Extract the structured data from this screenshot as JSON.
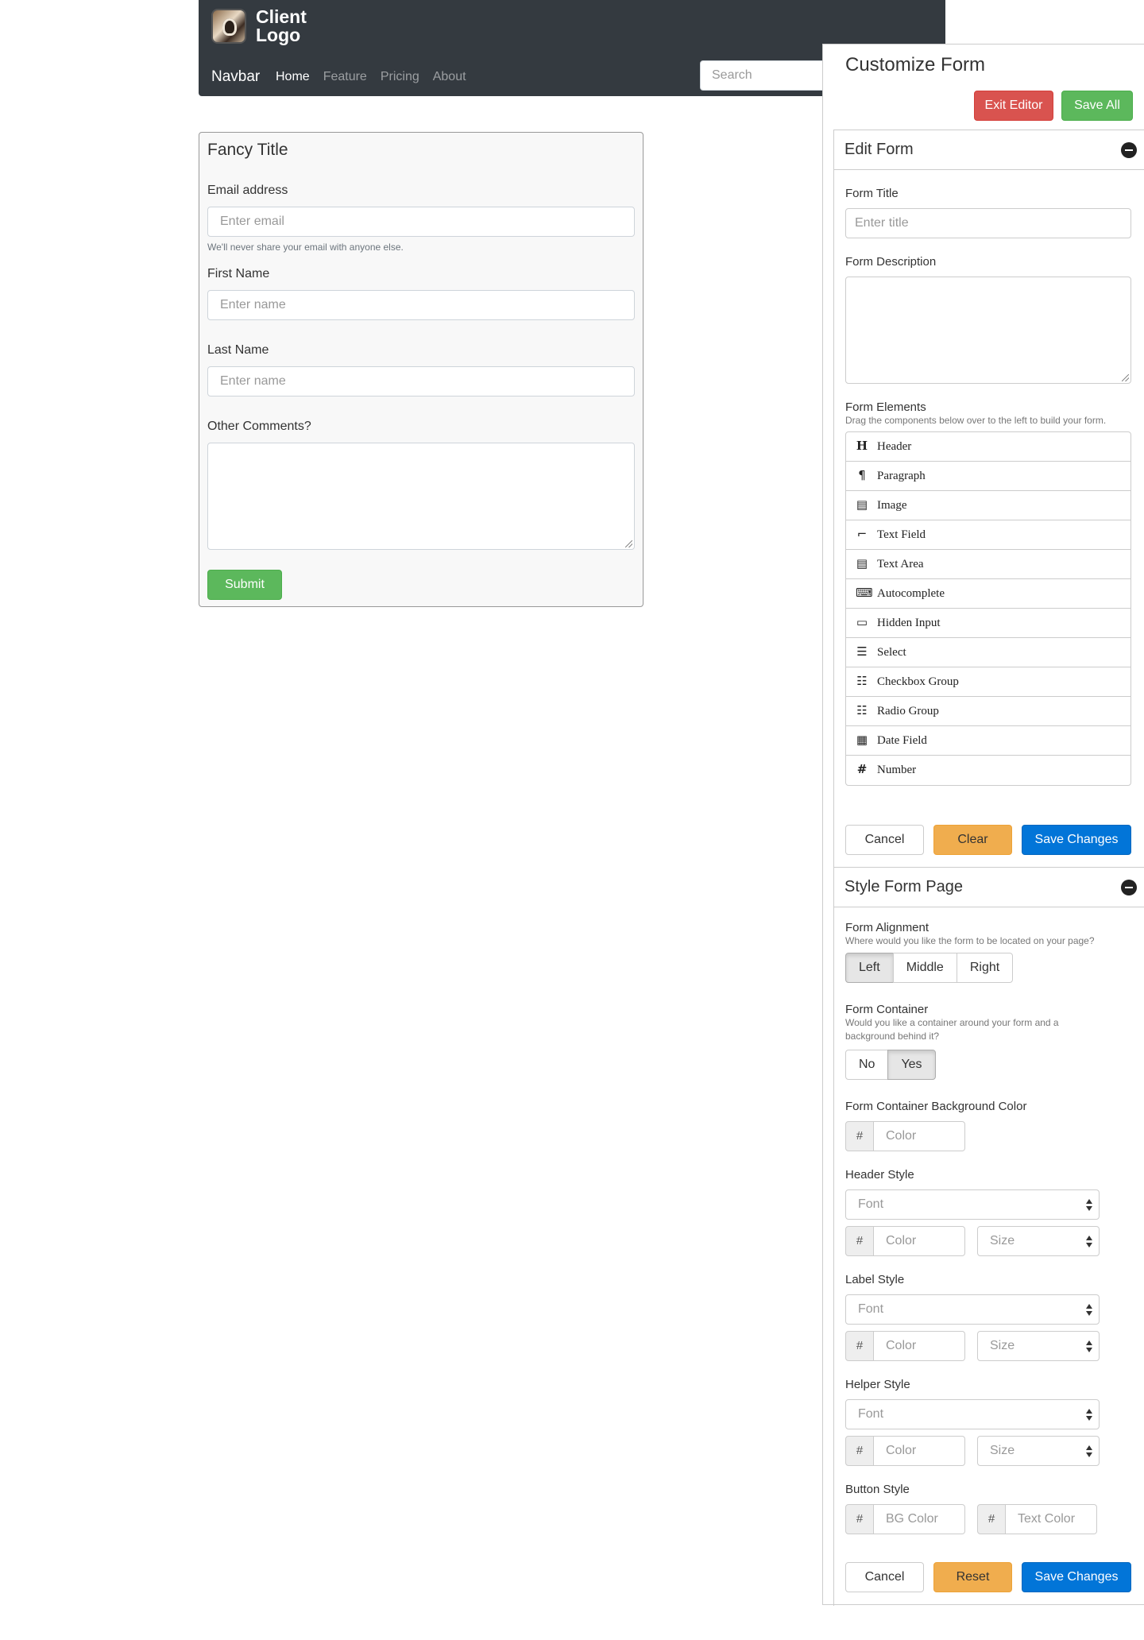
{
  "navbar": {
    "logo_line1": "Client",
    "logo_line2": "Logo",
    "brand": "Navbar",
    "links": [
      "Home",
      "Feature",
      "Pricing",
      "About"
    ],
    "search_placeholder": "Search"
  },
  "form": {
    "title": "Fancy Title",
    "email_label": "Email address",
    "email_placeholder": "Enter email",
    "email_help": "We'll never share your email with anyone else.",
    "first_name_label": "First Name",
    "first_name_placeholder": "Enter name",
    "last_name_label": "Last Name",
    "last_name_placeholder": "Enter name",
    "comments_label": "Other Comments?",
    "submit_label": "Submit"
  },
  "panel": {
    "toggle": "»",
    "title": "Customize Form",
    "exit_label": "Exit Editor",
    "save_all_label": "Save All",
    "edit_form": {
      "title": "Edit Form",
      "form_title_label": "Form Title",
      "form_title_placeholder": "Enter title",
      "form_description_label": "Form Description",
      "elements_label": "Form Elements",
      "elements_help": "Drag the components below over to the left to build your form.",
      "elements": [
        {
          "label": "Header",
          "icon": "header-icon",
          "glyph": "H"
        },
        {
          "label": "Paragraph",
          "icon": "paragraph-icon",
          "glyph": "¶"
        },
        {
          "label": "Image",
          "icon": "image-icon",
          "glyph": "▤"
        },
        {
          "label": "Text Field",
          "icon": "text-field-icon",
          "glyph": "⌐"
        },
        {
          "label": "Text Area",
          "icon": "text-area-icon",
          "glyph": "▤"
        },
        {
          "label": "Autocomplete",
          "icon": "autocomplete-icon",
          "glyph": "⌨"
        },
        {
          "label": "Hidden Input",
          "icon": "hidden-input-icon",
          "glyph": "▭"
        },
        {
          "label": "Select",
          "icon": "select-icon",
          "glyph": "☰"
        },
        {
          "label": "Checkbox Group",
          "icon": "checkbox-group-icon",
          "glyph": "☷"
        },
        {
          "label": "Radio Group",
          "icon": "radio-group-icon",
          "glyph": "☷"
        },
        {
          "label": "Date Field",
          "icon": "calendar-icon",
          "glyph": "▦"
        },
        {
          "label": "Number",
          "icon": "hash-icon",
          "glyph": "#"
        }
      ],
      "cancel_label": "Cancel",
      "clear_label": "Clear",
      "save_label": "Save Changes"
    },
    "style_page": {
      "title": "Style Form Page",
      "alignment_label": "Form Alignment",
      "alignment_help": "Where would you like the form to be located on your page?",
      "alignment_options": [
        "Left",
        "Middle",
        "Right"
      ],
      "alignment_selected": "Left",
      "container_label": "Form Container",
      "container_help": "Would you like a container around your form and a background behind it?",
      "container_options": [
        "No",
        "Yes"
      ],
      "container_selected": "Yes",
      "bg_color_label": "Form Container Background Color",
      "hash": "#",
      "color_placeholder": "Color",
      "header_style_label": "Header Style",
      "label_style_label": "Label Style",
      "helper_style_label": "Helper Style",
      "font_placeholder": "Font",
      "size_placeholder": "Size",
      "button_style_label": "Button Style",
      "bg_color_placeholder": "BG Color",
      "text_color_placeholder": "Text Color",
      "cancel_label": "Cancel",
      "reset_label": "Reset",
      "save_label": "Save Changes"
    }
  },
  "colors": {
    "navbar_bg": "#343a40",
    "success": "#5cb85c",
    "danger": "#d9534f",
    "warning": "#f0ad4e",
    "primary": "#0275d8"
  }
}
